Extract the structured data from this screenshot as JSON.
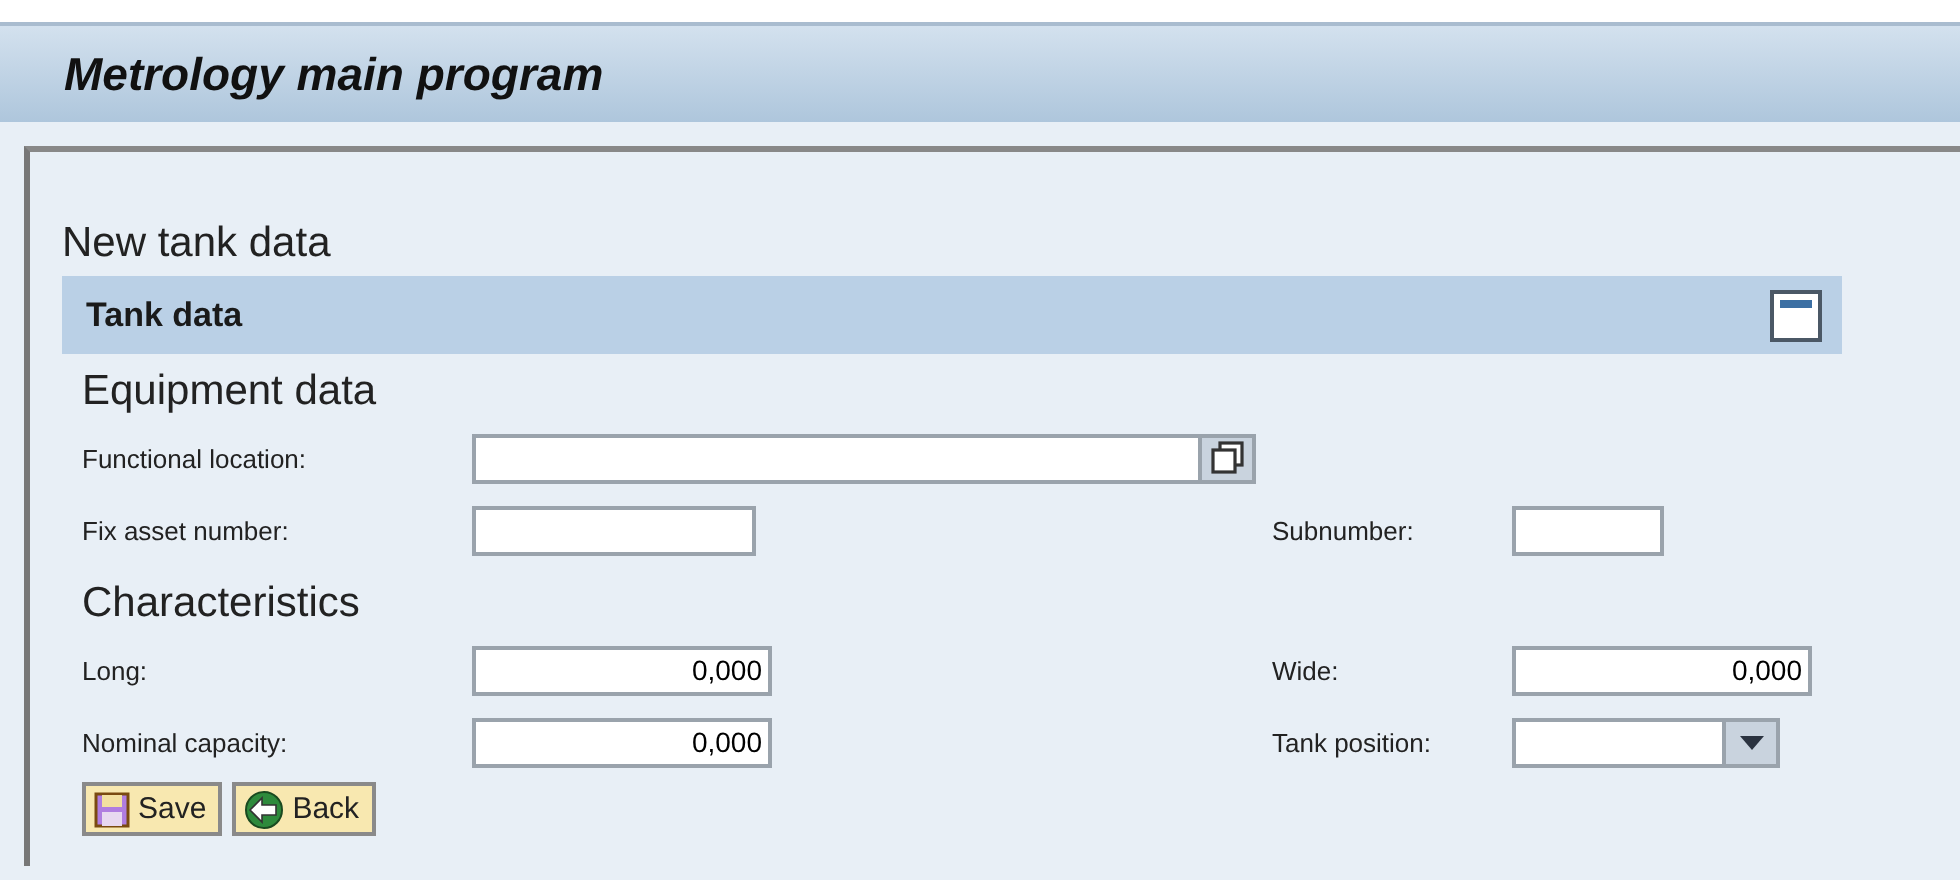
{
  "window": {
    "title": "Metrology main program"
  },
  "page_heading": "New tank data",
  "section": {
    "title": "Tank data",
    "expanded": true
  },
  "groups": [
    {
      "heading": "Equipment data",
      "rows": [
        {
          "left": {
            "label": "Functional location:",
            "kind": "help"
          }
        },
        {
          "left": {
            "label": "Fix asset number:",
            "kind": "short"
          },
          "right": {
            "label": "Subnumber:",
            "kind": "tiny"
          }
        }
      ]
    },
    {
      "heading": "Characteristics",
      "rows": [
        {
          "left": {
            "label": "Long:",
            "kind": "number",
            "value": "0,000"
          },
          "right": {
            "label": "Wide:",
            "kind": "number",
            "value": "0,000"
          }
        },
        {
          "left": {
            "label": "Nominal capacity:",
            "kind": "number",
            "value": "0,000"
          },
          "right": {
            "label": "Tank position:",
            "kind": "dropdown"
          }
        }
      ]
    }
  ],
  "buttons": [
    {
      "label": "Save",
      "kind": "save"
    },
    {
      "label": "Back",
      "kind": "back"
    }
  ]
}
